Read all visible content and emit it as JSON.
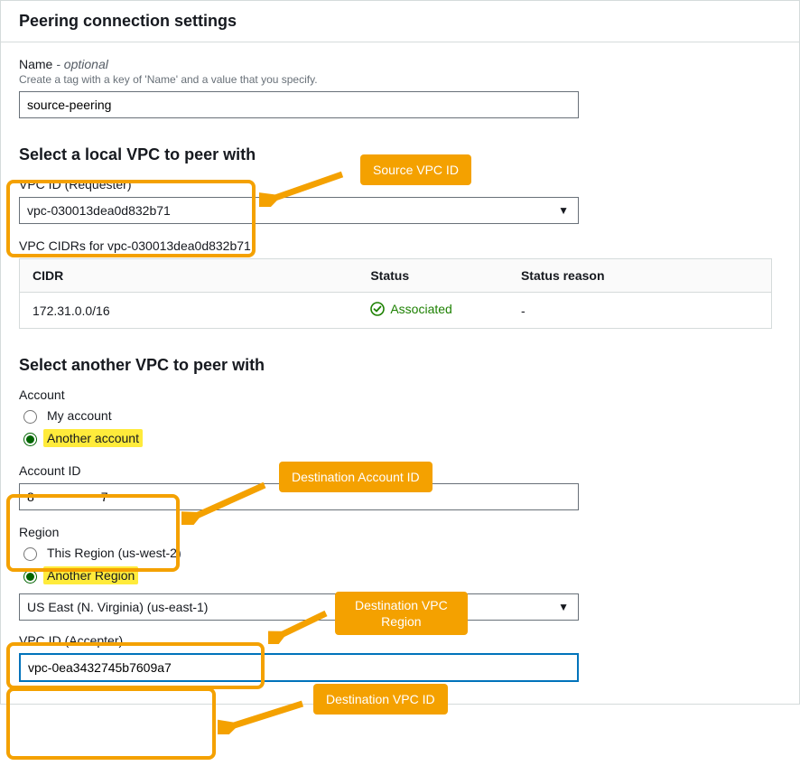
{
  "header": {
    "title": "Peering connection settings"
  },
  "name_field": {
    "label": "Name",
    "optional": "- optional",
    "helper": "Create a tag with a key of 'Name' and a value that you specify.",
    "value": "source-peering"
  },
  "local_vpc": {
    "section_title": "Select a local VPC to peer with",
    "vpc_id_label": "VPC ID (Requester)",
    "vpc_id_value": "vpc-030013dea0d832b71",
    "cidrs_title": "VPC CIDRs for vpc-030013dea0d832b71",
    "table": {
      "headers": {
        "cidr": "CIDR",
        "status": "Status",
        "reason": "Status reason"
      },
      "rows": [
        {
          "cidr": "172.31.0.0/16",
          "status": "Associated",
          "reason": "-"
        }
      ]
    }
  },
  "remote_vpc": {
    "section_title": "Select another VPC to peer with",
    "account_label": "Account",
    "account_options": {
      "mine": "My account",
      "other": "Another account"
    },
    "account_id_label": "Account ID",
    "account_id_value": "8                   7",
    "region_label": "Region",
    "region_options": {
      "this": "This Region (us-west-2)",
      "other": "Another Region"
    },
    "region_dropdown_value": "US East (N. Virginia) (us-east-1)",
    "accepter_label": "VPC ID (Accepter)",
    "accepter_value": "vpc-0ea3432745b7609a7"
  },
  "annotations": {
    "source_vpc": "Source VPC ID",
    "dest_account": "Destination Account ID",
    "dest_region": "Destination VPC\nRegion",
    "dest_vpc": "Destination VPC ID"
  }
}
